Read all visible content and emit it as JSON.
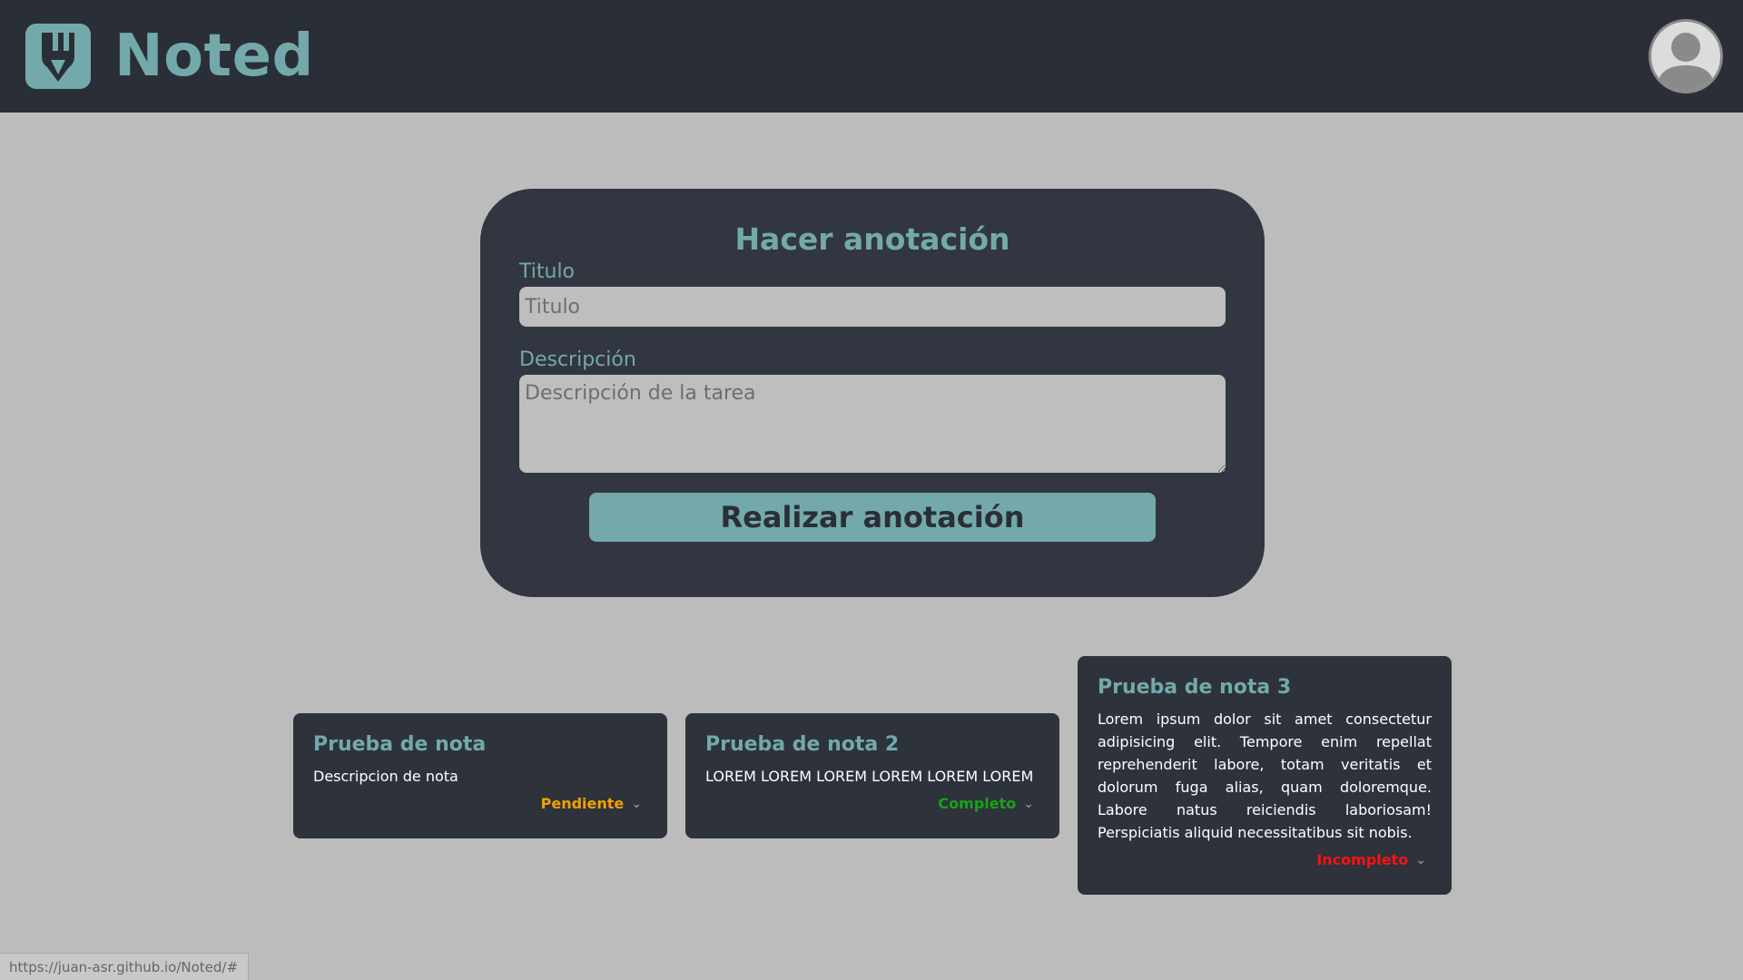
{
  "header": {
    "brand_name": "Noted",
    "logo_icon": "pencil-logo-icon",
    "avatar_icon": "user-avatar-icon"
  },
  "form": {
    "title": "Hacer anotación",
    "title_label": "Titulo",
    "title_placeholder": "Titulo",
    "description_label": "Descripción",
    "description_placeholder": "Descripción de la tarea",
    "submit_label": "Realizar anotación"
  },
  "notes": [
    {
      "title": "Prueba de nota",
      "description": "Descripcion de nota",
      "status": "Pendiente",
      "status_color": "#f0a202"
    },
    {
      "title": "Prueba de nota 2",
      "description": "LOREM LOREM LOREM LOREM LOREM LOREM",
      "status": "Completo",
      "status_color": "#17a317"
    },
    {
      "title": "Prueba de nota 3",
      "description": "Lorem ipsum dolor sit amet consectetur adipisicing elit. Tempore enim repellat reprehenderit labore, totam veritatis et dolorum fuga alias, quam doloremque. Labore natus reiciendis laboriosam! Perspiciatis aliquid necessitatibus sit nobis.",
      "status": "Incompleto",
      "status_color": "#ff1010"
    }
  ],
  "status_bar": {
    "url": "https://juan-asr.github.io/Noted/#"
  },
  "colors": {
    "accent": "#73a9aa",
    "header_bg": "#2a2f37",
    "card_bg": "#323640",
    "page_bg": "#bcbcbc"
  }
}
